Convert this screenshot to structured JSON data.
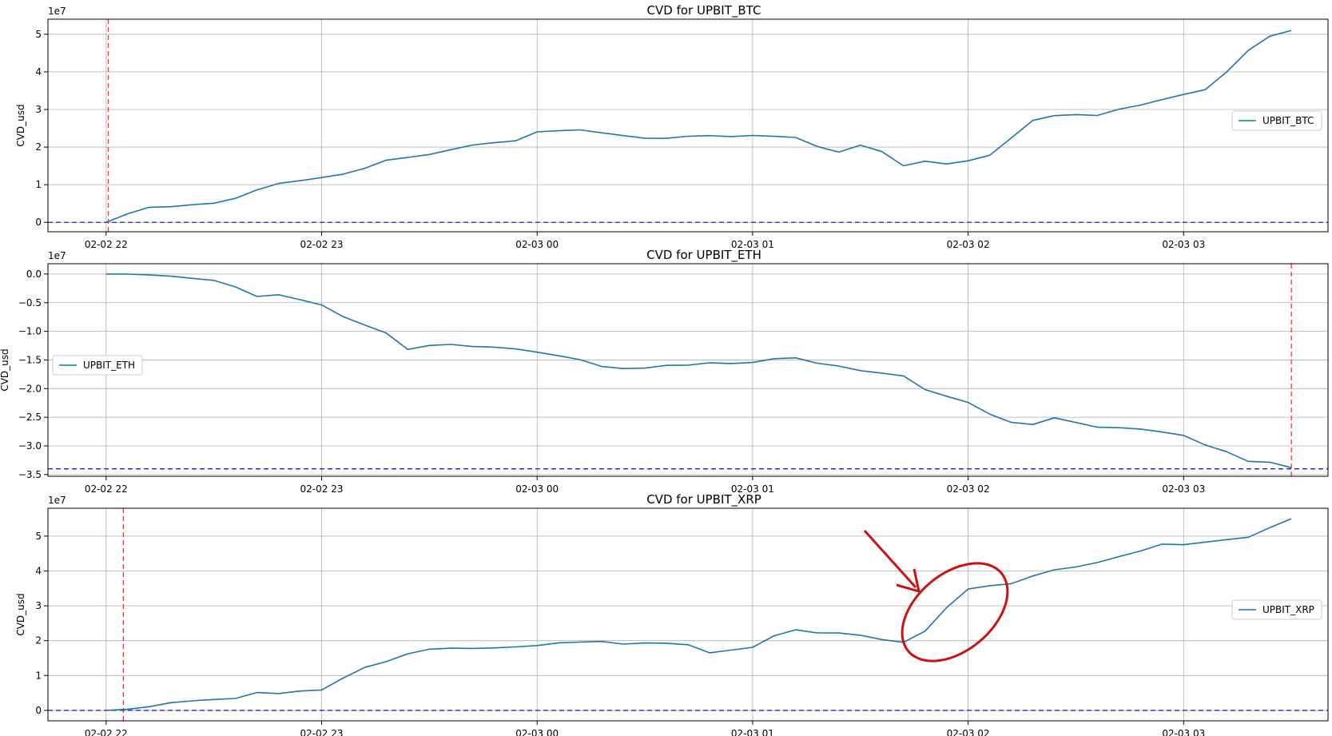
{
  "chart_data": [
    {
      "type": "line",
      "title": "CVD for UPBIT_BTC",
      "ylabel": "CVD_usd",
      "offset_text": "1e7",
      "x_tick_labels": [
        "02-02 22",
        "02-02 23",
        "02-03 00",
        "02-03 01",
        "02-03 02",
        "02-03 03"
      ],
      "xlim": [
        -0.27,
        5.67
      ],
      "ylim": [
        -0.25,
        5.4
      ],
      "y_ticks": [
        0,
        1,
        2,
        3,
        4,
        5
      ],
      "y_tick_labels": [
        "0",
        "1",
        "2",
        "3",
        "4",
        "5"
      ],
      "legend": "right",
      "grid": true,
      "zero_line": 0,
      "event_line_x": 0.01,
      "series": [
        {
          "name": "UPBIT_BTC",
          "color": "#1f77a4",
          "x": [
            0.0,
            0.1,
            0.2,
            0.3,
            0.4,
            0.5,
            0.6,
            0.7,
            0.8,
            0.9,
            1.0,
            1.1,
            1.2,
            1.3,
            1.4,
            1.5,
            1.6,
            1.7,
            1.8,
            1.9,
            2.0,
            2.1,
            2.2,
            2.3,
            2.4,
            2.5,
            2.6,
            2.7,
            2.8,
            2.9,
            3.0,
            3.1,
            3.2,
            3.3,
            3.4,
            3.5,
            3.6,
            3.7,
            3.8,
            3.9,
            4.0,
            4.1,
            4.2,
            4.3,
            4.4,
            4.5,
            4.6,
            4.7,
            4.8,
            4.9,
            5.0,
            5.1,
            5.2,
            5.3,
            5.4,
            5.5
          ],
          "values": [
            0.0,
            0.2,
            0.35,
            0.35,
            0.4,
            0.45,
            0.6,
            0.85,
            1.05,
            1.15,
            1.25,
            1.35,
            1.5,
            1.7,
            1.75,
            1.8,
            1.9,
            2.0,
            2.05,
            2.1,
            2.35,
            2.4,
            2.45,
            2.4,
            2.35,
            2.3,
            2.3,
            2.35,
            2.35,
            2.3,
            2.3,
            2.25,
            2.2,
            1.95,
            1.8,
            2.0,
            1.85,
            1.5,
            1.65,
            1.6,
            1.7,
            1.85,
            2.3,
            2.75,
            2.85,
            2.85,
            2.8,
            2.95,
            3.05,
            3.2,
            3.35,
            3.5,
            4.0,
            4.6,
            5.0,
            5.1
          ]
        }
      ]
    },
    {
      "type": "line",
      "title": "CVD for UPBIT_ETH",
      "ylabel": "CVD_usd",
      "offset_text": "1e7",
      "x_tick_labels": [
        "02-02 22",
        "02-02 23",
        "02-03 00",
        "02-03 01",
        "02-03 02",
        "02-03 03"
      ],
      "xlim": [
        -0.27,
        5.67
      ],
      "ylim": [
        -3.53,
        0.18
      ],
      "y_ticks": [
        0.0,
        -0.5,
        -1.0,
        -1.5,
        -2.0,
        -2.5,
        -3.0,
        -3.5
      ],
      "y_tick_labels": [
        "0.0",
        "−0.5",
        "−1.0",
        "−1.5",
        "−2.0",
        "−2.5",
        "−3.0",
        "−3.5"
      ],
      "legend": "left",
      "grid": true,
      "zero_line": -3.4,
      "event_line_x": 5.5,
      "series": [
        {
          "name": "UPBIT_ETH",
          "color": "#1f77a4",
          "x": [
            0.0,
            0.1,
            0.2,
            0.3,
            0.4,
            0.5,
            0.6,
            0.7,
            0.8,
            0.9,
            1.0,
            1.1,
            1.2,
            1.3,
            1.4,
            1.5,
            1.6,
            1.7,
            1.8,
            1.9,
            2.0,
            2.1,
            2.2,
            2.3,
            2.4,
            2.5,
            2.6,
            2.7,
            2.8,
            2.9,
            3.0,
            3.1,
            3.2,
            3.3,
            3.4,
            3.5,
            3.6,
            3.7,
            3.8,
            3.9,
            4.0,
            4.1,
            4.2,
            4.3,
            4.4,
            4.5,
            4.6,
            4.7,
            4.8,
            4.9,
            5.0,
            5.1,
            5.2,
            5.3,
            5.4,
            5.5
          ],
          "values": [
            0.0,
            -0.02,
            -0.05,
            -0.08,
            -0.12,
            -0.15,
            -0.25,
            -0.4,
            -0.35,
            -0.42,
            -0.5,
            -0.7,
            -0.85,
            -1.0,
            -1.3,
            -1.25,
            -1.25,
            -1.3,
            -1.32,
            -1.35,
            -1.4,
            -1.45,
            -1.5,
            -1.6,
            -1.62,
            -1.6,
            -1.55,
            -1.55,
            -1.52,
            -1.55,
            -1.55,
            -1.5,
            -1.5,
            -1.6,
            -1.65,
            -1.72,
            -1.75,
            -1.78,
            -2.0,
            -2.1,
            -2.2,
            -2.4,
            -2.55,
            -2.6,
            -2.5,
            -2.6,
            -2.7,
            -2.72,
            -2.75,
            -2.8,
            -2.85,
            -3.0,
            -3.1,
            -3.25,
            -3.25,
            -3.38
          ]
        }
      ]
    },
    {
      "type": "line",
      "title": "CVD for UPBIT_XRP",
      "ylabel": "CVD_usd",
      "offset_text": "1e7",
      "x_tick_labels": [
        "02-02 22",
        "02-02 23",
        "02-03 00",
        "02-03 01",
        "02-03 02",
        "02-03 03"
      ],
      "xlim": [
        -0.27,
        5.67
      ],
      "ylim": [
        -0.3,
        5.8
      ],
      "y_ticks": [
        0,
        1,
        2,
        3,
        4,
        5
      ],
      "y_tick_labels": [
        "0",
        "1",
        "2",
        "3",
        "4",
        "5"
      ],
      "legend": "right",
      "grid": true,
      "zero_line": 0,
      "event_line_x": 0.08,
      "series": [
        {
          "name": "UPBIT_XRP",
          "color": "#1f77a4",
          "x": [
            0.0,
            0.1,
            0.2,
            0.3,
            0.4,
            0.5,
            0.6,
            0.7,
            0.8,
            0.9,
            1.0,
            1.1,
            1.2,
            1.3,
            1.4,
            1.5,
            1.6,
            1.7,
            1.8,
            1.9,
            2.0,
            2.1,
            2.2,
            2.3,
            2.4,
            2.5,
            2.6,
            2.7,
            2.8,
            2.9,
            3.0,
            3.1,
            3.2,
            3.3,
            3.4,
            3.5,
            3.6,
            3.7,
            3.8,
            3.9,
            4.0,
            4.1,
            4.2,
            4.3,
            4.4,
            4.5,
            4.6,
            4.7,
            4.8,
            4.9,
            5.0,
            5.1,
            5.2,
            5.3,
            5.4,
            5.5
          ],
          "values": [
            0.0,
            0.0,
            0.05,
            0.15,
            0.2,
            0.25,
            0.3,
            0.5,
            0.5,
            0.6,
            0.65,
            1.0,
            1.3,
            1.45,
            1.65,
            1.75,
            1.75,
            1.72,
            1.72,
            1.75,
            1.8,
            1.9,
            1.95,
            2.0,
            1.95,
            2.0,
            2.0,
            1.95,
            1.7,
            1.75,
            1.8,
            2.1,
            2.25,
            2.15,
            2.15,
            2.1,
            2.0,
            1.95,
            2.3,
            3.0,
            3.55,
            3.65,
            3.7,
            3.9,
            4.05,
            4.1,
            4.2,
            4.35,
            4.5,
            4.7,
            4.7,
            4.8,
            4.9,
            5.0,
            5.3,
            5.5
          ]
        }
      ]
    }
  ]
}
